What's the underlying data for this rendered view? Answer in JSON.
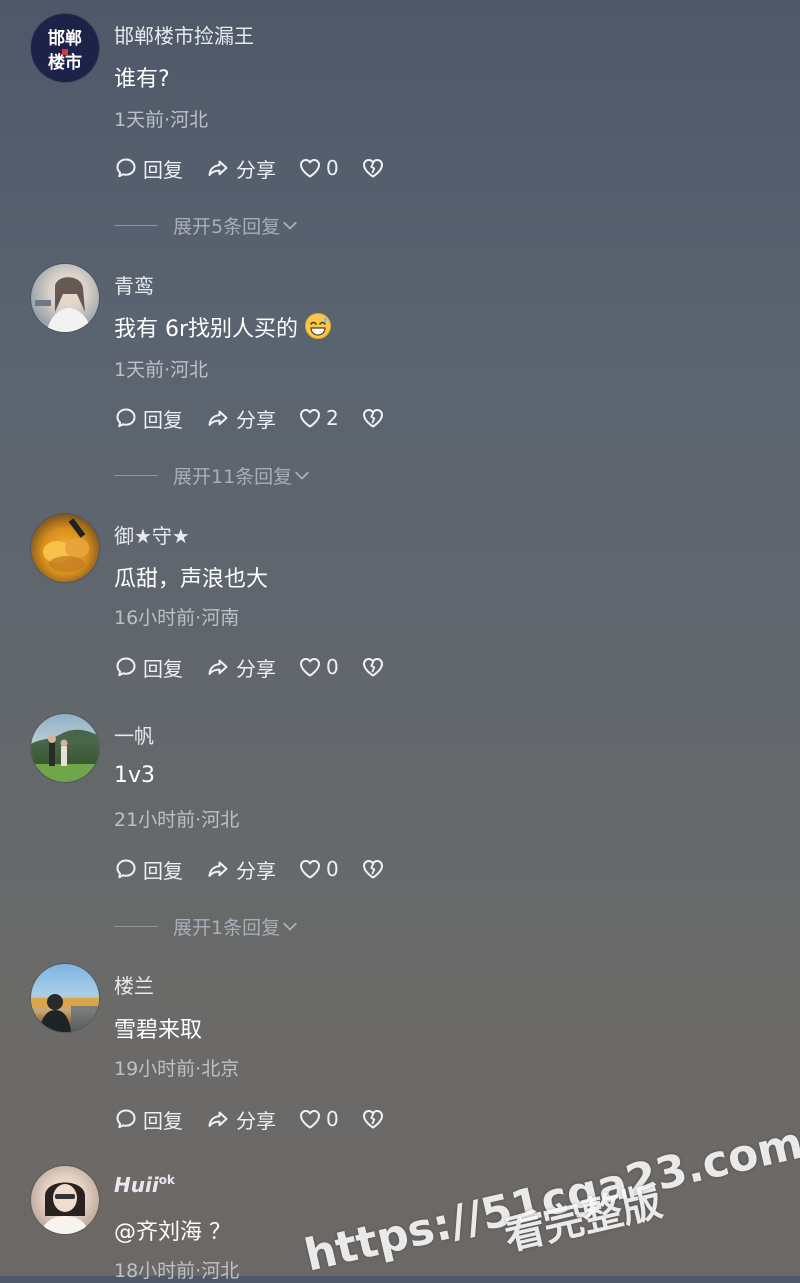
{
  "comments": [
    {
      "username": "邯郸楼市捡漏王",
      "text": "谁有?",
      "meta": "1天前·河北",
      "reply_label": "回复",
      "share_label": "分享",
      "likes": "0",
      "expand_label": "展开5条回复",
      "avatar_logo": "邯郸楼市"
    },
    {
      "username": "青鸾",
      "text": "我有 6r找别人买的",
      "emoji": "grinning-sweat-emoji",
      "meta": "1天前·河北",
      "reply_label": "回复",
      "share_label": "分享",
      "likes": "2",
      "expand_label": "展开11条回复"
    },
    {
      "username": "御★守★",
      "text": "瓜甜，声浪也大",
      "meta": "16小时前·河南",
      "reply_label": "回复",
      "share_label": "分享",
      "likes": "0"
    },
    {
      "username": "一帆",
      "text": "1v3",
      "meta": "21小时前·河北",
      "reply_label": "回复",
      "share_label": "分享",
      "likes": "0",
      "expand_label": "展开1条回复"
    },
    {
      "username": "楼兰",
      "text": "雪碧来取",
      "meta": "19小时前·北京",
      "reply_label": "回复",
      "share_label": "分享",
      "likes": "0"
    },
    {
      "username": "Huii",
      "username_badge": "ok",
      "text": "@齐刘海 ？",
      "meta": "18小时前·河北"
    }
  ],
  "watermark": {
    "url": "https://51cga23.com",
    "subtitle": "看完整版"
  },
  "colors": {
    "background_top": "#4e5868",
    "background_bottom": "#6c6866",
    "avatar_brand": "#1c2248",
    "avatar_brand_accent": "#d23a3a"
  }
}
